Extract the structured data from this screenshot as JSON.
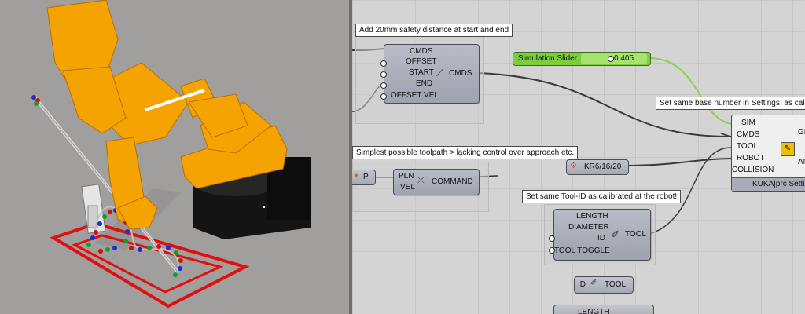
{
  "canvas": {
    "notes": {
      "safety": "Add 20mm safety distance at start and end",
      "base": "Set same base number in Settings, as calibr",
      "toolpath": "Simplest possible toolpath > lacking control over approach etc.",
      "toolid": "Set same Tool-ID as calibrated at the robot!"
    },
    "safety_comp": {
      "inputs": [
        "CMDS",
        "OFFSET",
        "START",
        "END",
        "OFFSET VEL"
      ],
      "output": "CMDS",
      "icon": "kuka-safety-icon"
    },
    "slider": {
      "name": "Simulation Slider",
      "value": "0.405"
    },
    "core": {
      "inputs": [
        "SIM",
        "CMDS",
        "TOOL",
        "ROBOT",
        "COLLISION"
      ],
      "outputs": [
        "GE",
        "AN"
      ],
      "footer": "KUKA|prc Setti",
      "icon": "kuka-core-icon"
    },
    "p_param": {
      "label": "P"
    },
    "command": {
      "inputs": [
        "PLN",
        "VEL"
      ],
      "output": "COMMAND",
      "icon": "lin-icon"
    },
    "robot": {
      "label": "KR6/16/20",
      "icon": "robot-arm-icon"
    },
    "tool": {
      "inputs": [
        "LENGTH",
        "DIAMETER",
        "ID",
        "TOOL TOGGLE"
      ],
      "output": "TOOL",
      "icon": "tool-icon"
    },
    "tool2": {
      "input": "ID",
      "output": "TOOL"
    },
    "bottom": {
      "label": "LENGTH"
    }
  },
  "colors": {
    "robot": "#f5a300",
    "frame": "#e01010",
    "slider": "#7ccf3c",
    "wire": "#3a3a3a",
    "slider_wire": "#8ccf4a"
  }
}
